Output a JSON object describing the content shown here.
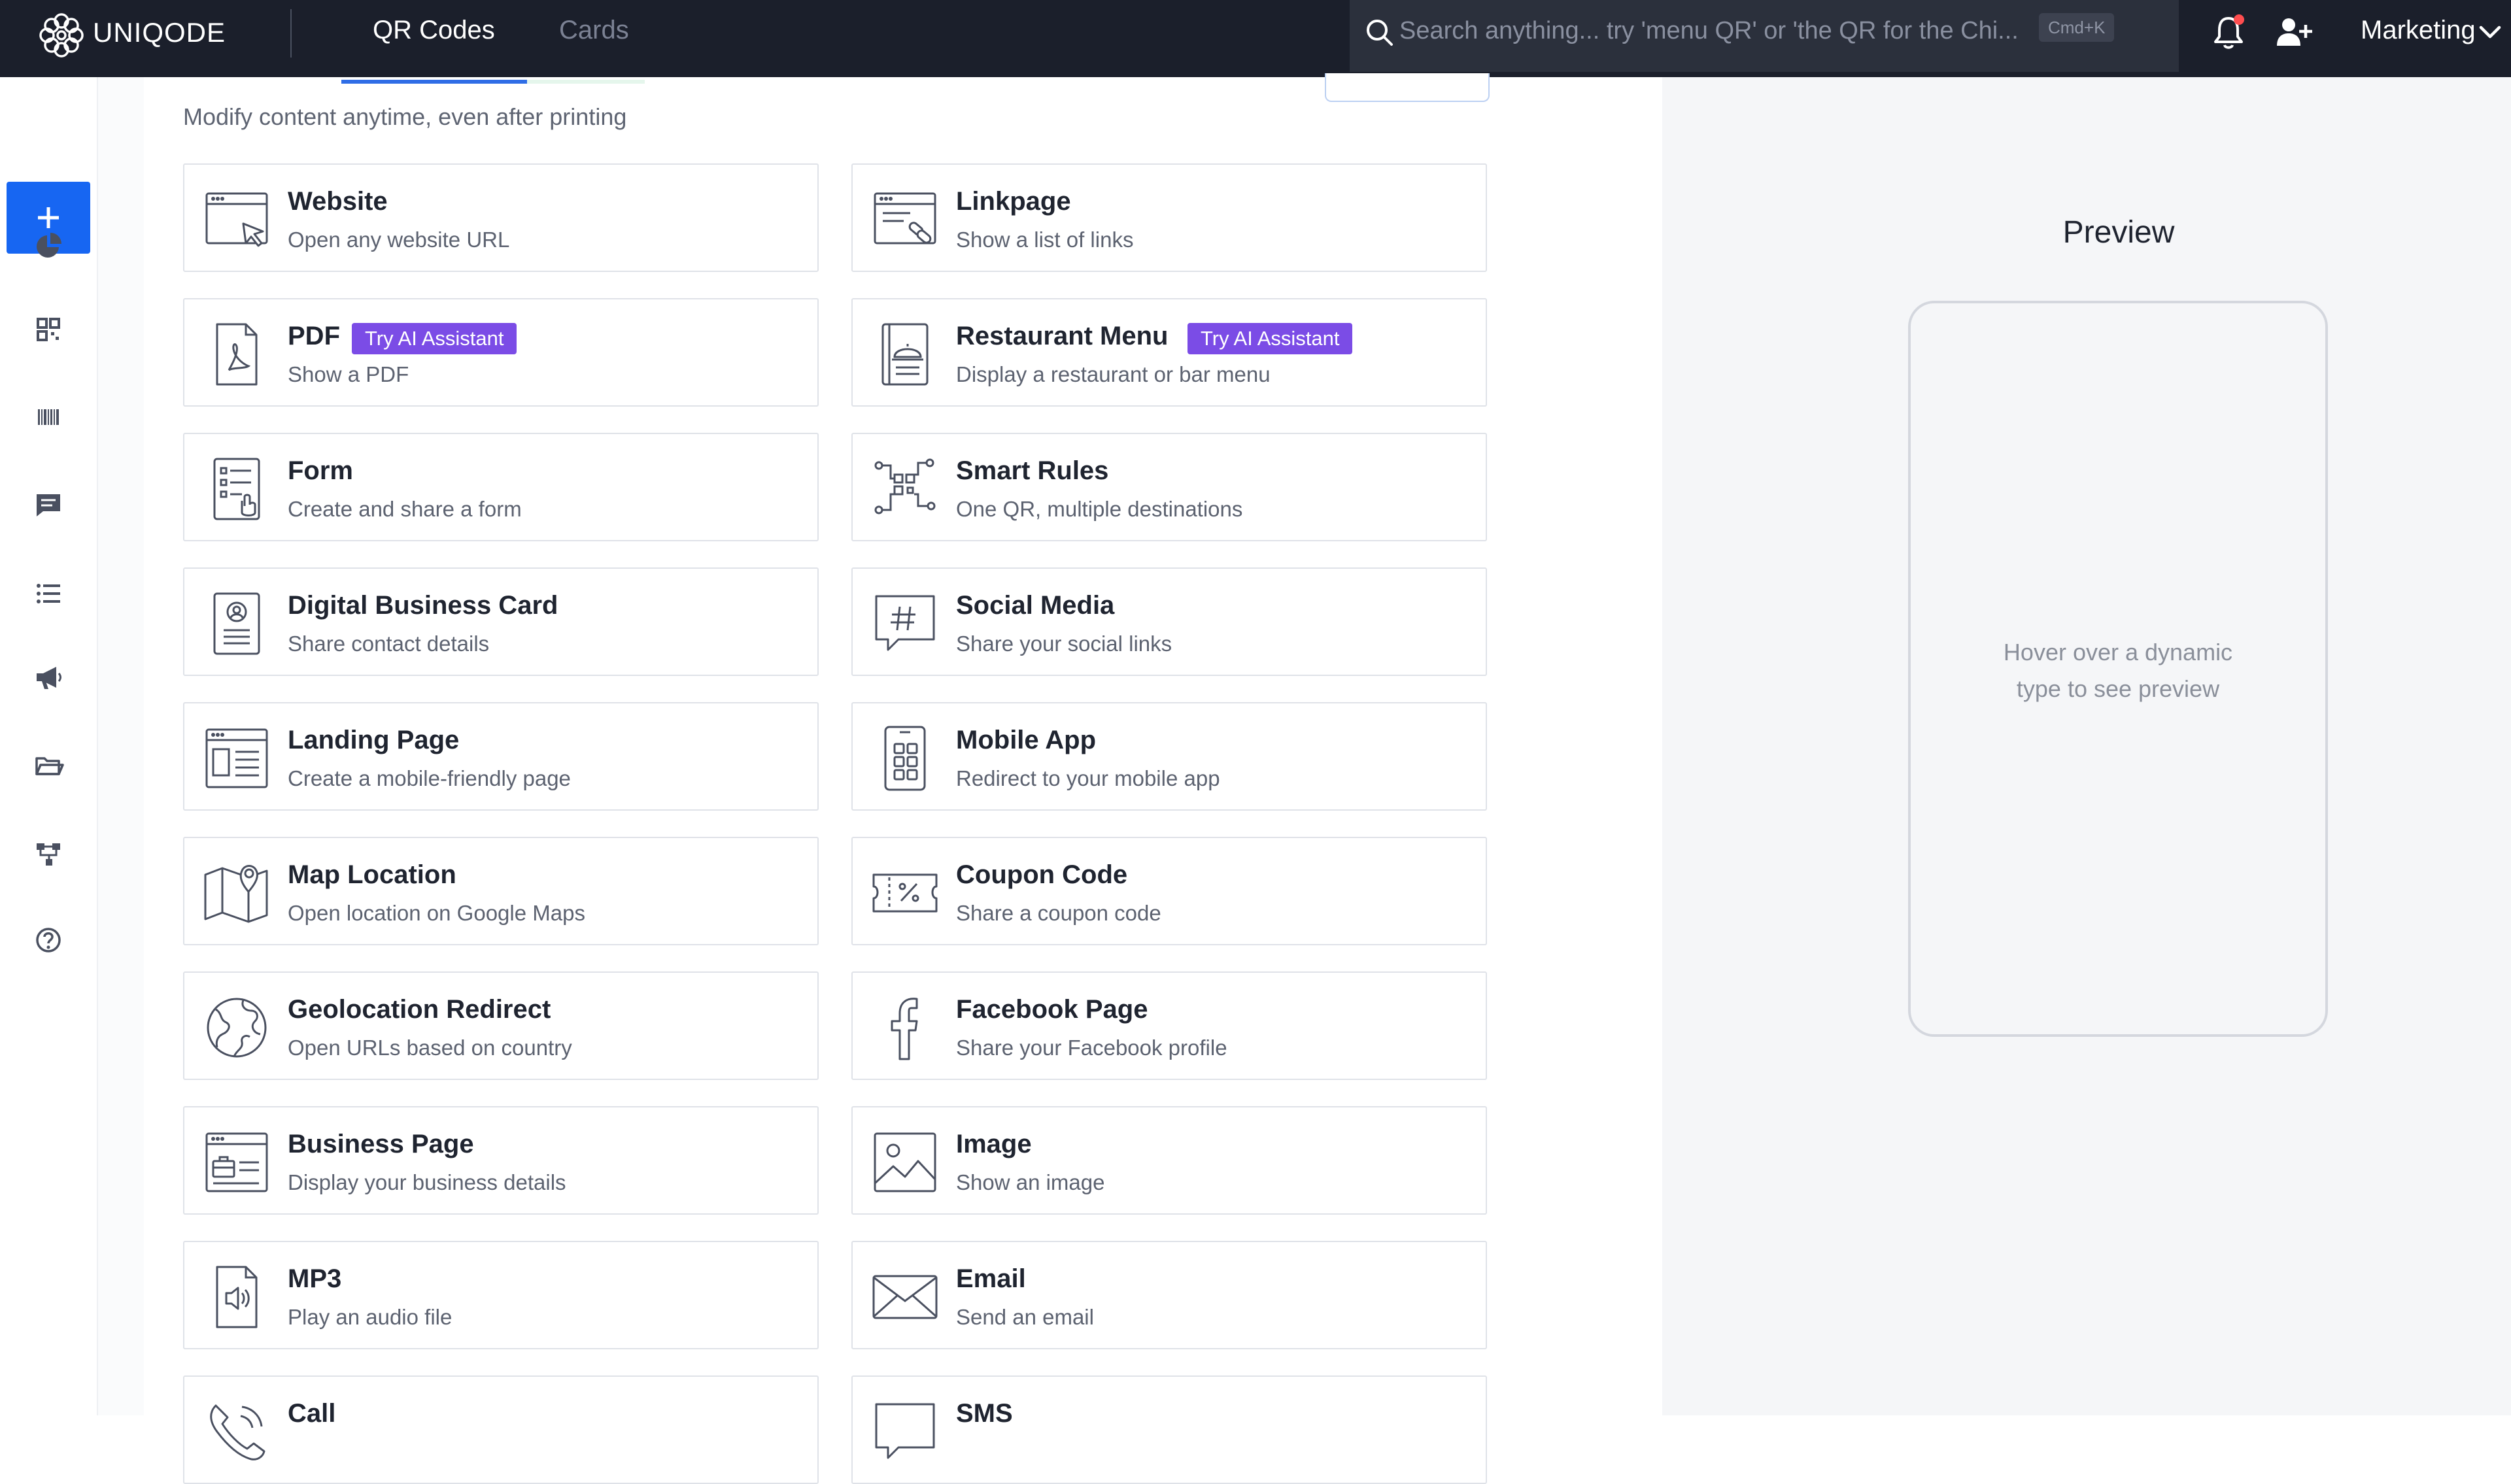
{
  "app": {
    "logo_text": "UNIQODE"
  },
  "top_tabs": [
    {
      "label": "QR Codes",
      "active": true
    },
    {
      "label": "Cards",
      "active": false
    }
  ],
  "search": {
    "placeholder": "Search anything... try 'menu QR' or 'the QR for the Chi...",
    "shortcut": "Cmd+K"
  },
  "account": {
    "workspace": "Marketing"
  },
  "rail": {
    "icons": [
      "plus-icon",
      "analytics-pie-icon",
      "qr-grid-icon",
      "barcode-icon",
      "message-icon",
      "list-icon",
      "megaphone-icon",
      "folder-icon",
      "integration-icon",
      "help-icon"
    ]
  },
  "main": {
    "subtitle": "Modify content anytime, even after printing",
    "types": [
      {
        "icon": "website-icon",
        "title": "Website",
        "desc": "Open any website URL"
      },
      {
        "icon": "linkpage-icon",
        "title": "Linkpage",
        "desc": "Show a list of links"
      },
      {
        "icon": "pdf-icon",
        "title": "PDF",
        "desc": "Show a PDF",
        "badge": "Try AI Assistant"
      },
      {
        "icon": "restaurant-menu-icon",
        "title": "Restaurant Menu",
        "desc": "Display a restaurant or bar menu",
        "badge": "Try AI Assistant"
      },
      {
        "icon": "form-icon",
        "title": "Form",
        "desc": "Create and share a form"
      },
      {
        "icon": "smart-rules-icon",
        "title": "Smart Rules",
        "desc": "One QR, multiple destinations"
      },
      {
        "icon": "business-card-icon",
        "title": "Digital Business Card",
        "desc": "Share contact details"
      },
      {
        "icon": "social-media-icon",
        "title": "Social Media",
        "desc": "Share your social links"
      },
      {
        "icon": "landing-page-icon",
        "title": "Landing Page",
        "desc": "Create a mobile-friendly page"
      },
      {
        "icon": "mobile-app-icon",
        "title": "Mobile App",
        "desc": "Redirect to your mobile app"
      },
      {
        "icon": "map-location-icon",
        "title": "Map Location",
        "desc": "Open location on Google Maps"
      },
      {
        "icon": "coupon-icon",
        "title": "Coupon Code",
        "desc": "Share a coupon code"
      },
      {
        "icon": "globe-icon",
        "title": "Geolocation Redirect",
        "desc": "Open URLs based on country"
      },
      {
        "icon": "facebook-icon",
        "title": "Facebook Page",
        "desc": "Share your Facebook profile"
      },
      {
        "icon": "business-page-icon",
        "title": "Business Page",
        "desc": "Display your business details"
      },
      {
        "icon": "image-icon",
        "title": "Image",
        "desc": "Show an image"
      },
      {
        "icon": "mp3-icon",
        "title": "MP3",
        "desc": "Play an audio file"
      },
      {
        "icon": "email-icon",
        "title": "Email",
        "desc": "Send an email"
      },
      {
        "icon": "call-icon",
        "title": "Call",
        "desc": ""
      },
      {
        "icon": "sms-icon",
        "title": "SMS",
        "desc": ""
      }
    ]
  },
  "preview": {
    "title": "Preview",
    "hint": "Hover over a dynamic type to see preview"
  },
  "colors": {
    "topbar": "#1b1f2b",
    "accent": "#1766f2",
    "badge": "#7b4ce6",
    "notification": "#ff4d4f"
  }
}
